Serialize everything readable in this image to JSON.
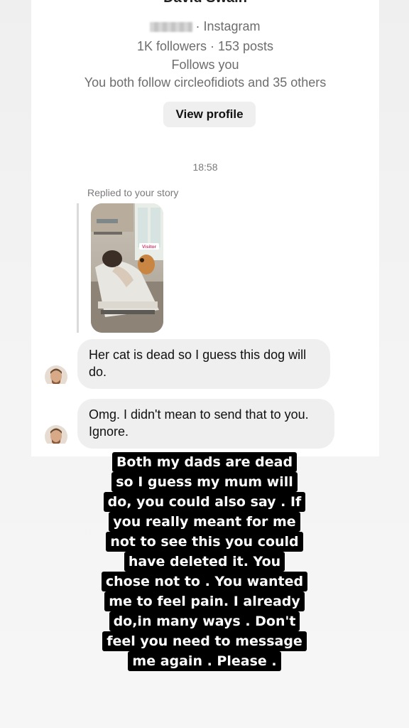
{
  "profile": {
    "name_partial": "David Swain",
    "platform": "· Instagram",
    "stats": "1K followers · 153 posts",
    "follows_you": "Follows you",
    "mutual": "You both follow circleofidiots and 35 others",
    "view_profile_label": "View profile"
  },
  "conversation": {
    "timestamp": "18:58",
    "replied_label": "Replied to your story",
    "story_sticker": "Visitor",
    "messages": [
      {
        "line1": "Her cat is dead so I guess this dog will",
        "line2": "do."
      },
      {
        "line1": "Omg. I didn't mean to send that to you.",
        "line2": "Ignore."
      }
    ]
  },
  "overlay_text": {
    "lines": [
      "Both my dads are dead",
      "so I guess my mum will",
      "do, you could also say . If",
      "you really meant for me",
      "not to see this you could",
      "have deleted it. You",
      "chose not to . You wanted",
      "me to feel pain. I already",
      "do,in many ways . Don't",
      "feel you need to message",
      "me again . Please ."
    ]
  }
}
